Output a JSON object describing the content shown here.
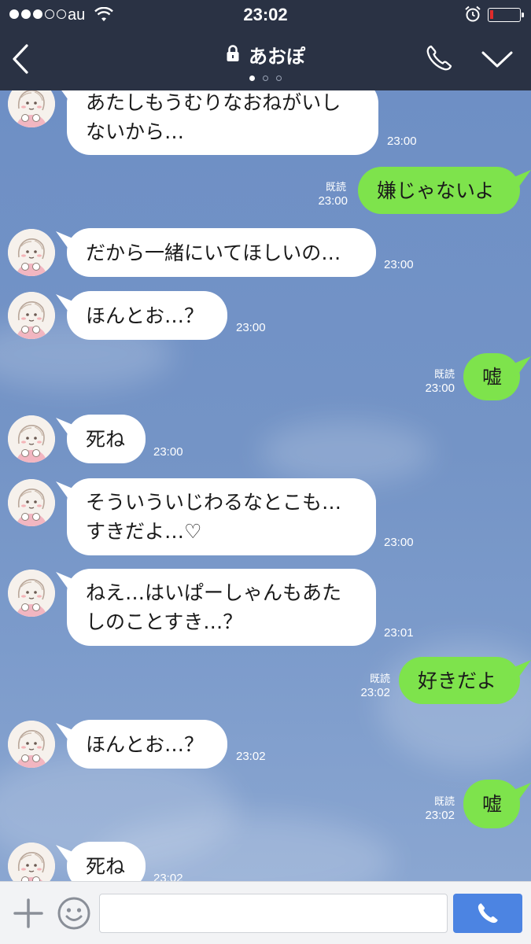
{
  "status_bar": {
    "carrier": "au",
    "time": "23:02",
    "signal_bars_filled": 3,
    "signal_bars_total": 5,
    "battery_level": 0.08
  },
  "header": {
    "title": "あおぽ",
    "page_dots": 3,
    "active_page": 0
  },
  "colors": {
    "header_bg": "#2a3244",
    "chat_bg": "#7494c6",
    "outgoing_bubble": "#7ee34c",
    "incoming_bubble": "#ffffff",
    "call_button": "#4c84e2",
    "battery_low": "#e02b2b"
  },
  "messages": [
    {
      "dir": "in",
      "text": "あたしもうむりなおねがいし\nないから…",
      "time": "23:00"
    },
    {
      "dir": "out",
      "text": "嫌じゃないよ",
      "time": "23:00",
      "read": "既読"
    },
    {
      "dir": "in",
      "text": "だから一緒にいてほしいの…",
      "time": "23:00"
    },
    {
      "dir": "in",
      "text": "ほんとお…？",
      "time": "23:00"
    },
    {
      "dir": "out",
      "text": "嘘",
      "time": "23:00",
      "read": "既読"
    },
    {
      "dir": "in",
      "text": "死ね",
      "time": "23:00"
    },
    {
      "dir": "in",
      "text": "そういういじわるなとこも…\nすきだよ…♡",
      "time": "23:00"
    },
    {
      "dir": "in",
      "text": "ねえ…はいぱーしゃんもあた\nしのことすき…？",
      "time": "23:01"
    },
    {
      "dir": "out",
      "text": "好きだよ",
      "time": "23:02",
      "read": "既読"
    },
    {
      "dir": "in",
      "text": "ほんとお…？",
      "time": "23:02"
    },
    {
      "dir": "out",
      "text": "嘘",
      "time": "23:02",
      "read": "既読"
    },
    {
      "dir": "in",
      "text": "死ね",
      "time": "23:02"
    }
  ],
  "input": {
    "placeholder": "",
    "value": ""
  },
  "icons": {
    "back": "chevron-left-icon",
    "lock": "lock-icon",
    "call": "phone-icon",
    "menu": "chevron-down-icon",
    "plus": "plus-icon",
    "emoji": "smiley-icon",
    "voice_call": "phone-icon"
  }
}
